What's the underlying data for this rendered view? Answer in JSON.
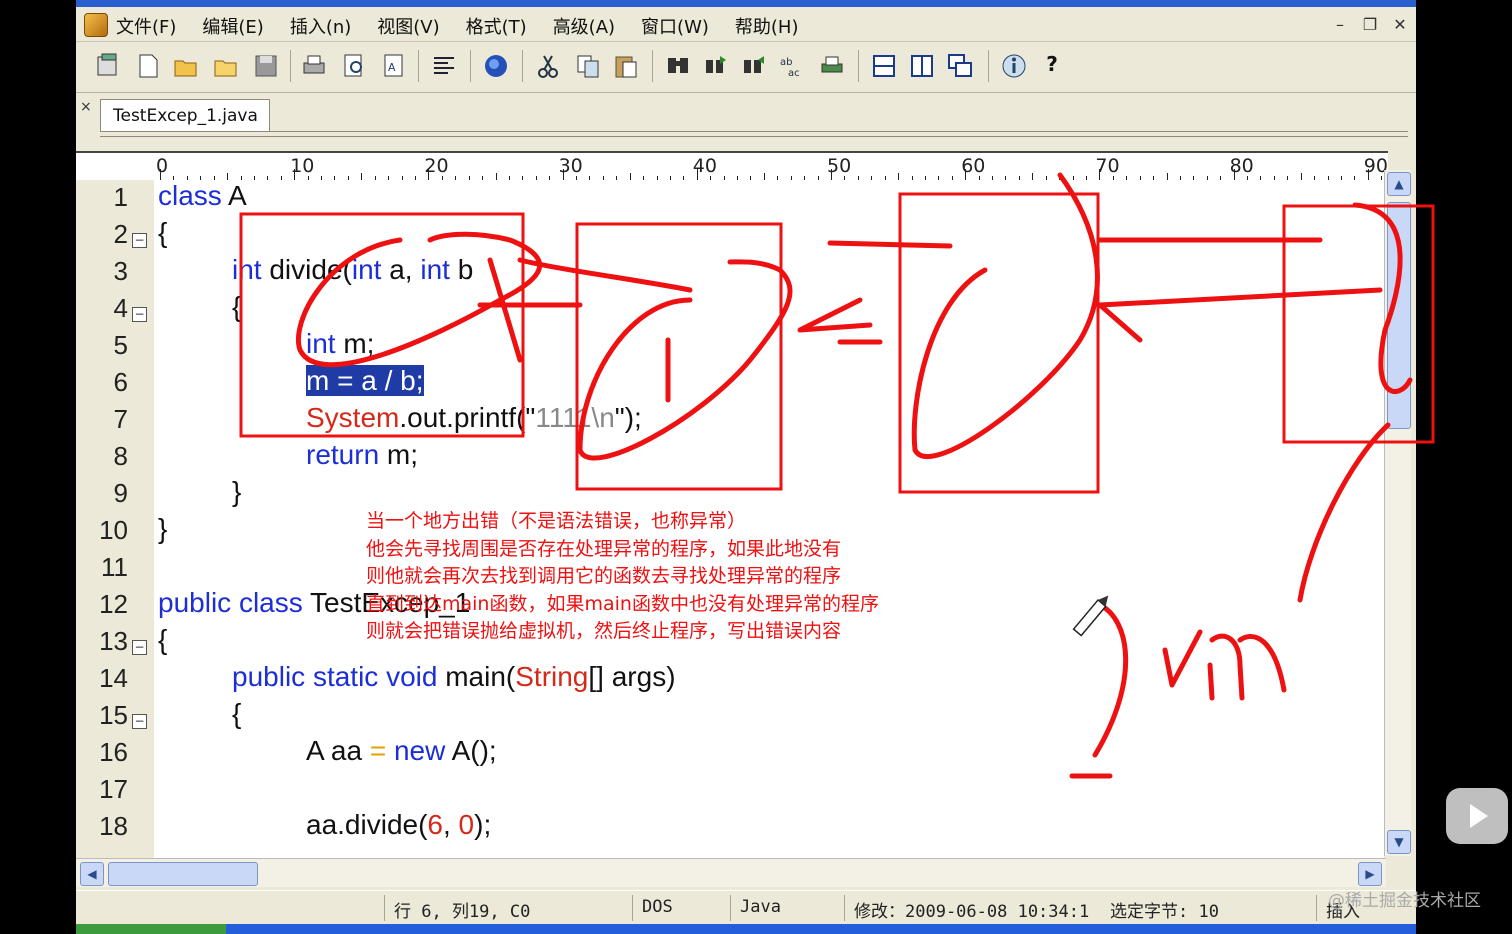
{
  "menu": {
    "items": [
      "文件(F)",
      "编辑(E)",
      "插入(n)",
      "视图(V)",
      "格式(T)",
      "高级(A)",
      "窗口(W)",
      "帮助(H)"
    ],
    "minimize": "–",
    "restore": "❐",
    "close": "✕"
  },
  "toolbar": {
    "icons": [
      "new-project-icon",
      "new-file-icon",
      "open-folder-icon",
      "open-folder-2-icon",
      "save-icon",
      "print-icon",
      "print-preview-icon",
      "spell-check-icon",
      "format-icon",
      "browser-icon",
      "cut-icon",
      "copy-icon",
      "paste-icon",
      "find-icon",
      "find-next-icon",
      "find-prev-icon",
      "replace-icon",
      "print-2-icon",
      "split-horizontal-icon",
      "split-vertical-icon",
      "cascade-icon",
      "info-icon",
      "help-icon"
    ],
    "help_label": "?"
  },
  "tabs": {
    "close_label": "×",
    "active": "TestExcep_1.java"
  },
  "ruler": {
    "labels": [
      "0",
      "10",
      "20",
      "30",
      "40",
      "50",
      "60",
      "70",
      "80",
      "90"
    ]
  },
  "editor": {
    "line_numbers": [
      "1",
      "2",
      "3",
      "4",
      "5",
      "6",
      "7",
      "8",
      "9",
      "10",
      "11",
      "12",
      "13",
      "14",
      "15",
      "16",
      "17",
      "18"
    ],
    "lines": {
      "l1_kw": "class",
      "l1_rest": " A",
      "l2": "{",
      "l3_kw1": "int",
      "l3_mid": " divide(",
      "l3_kw2": "int",
      "l3_mid2": " a, ",
      "l3_kw3": "int",
      "l3_end": " b",
      "l4": "{",
      "l5_kw": "int",
      "l5_rest": " m;",
      "l6_sel": "m = a / b;",
      "l7_cls": "System",
      "l7_mid": ".out.printf(\"",
      "l7_str": "1111\\n",
      "l7_end": "\");",
      "l8_kw": "return",
      "l8_rest": " m;",
      "l9": "}",
      "l10": "}",
      "l12_kw": "public class",
      "l12_rest": " TestExcep_1",
      "l13": "{",
      "l14_kw": "public static void",
      "l14_mid": " main(",
      "l14_cls": "String",
      "l14_end": "[] args)",
      "l15": "{",
      "l16_pre": "A aa ",
      "l16_op": "=",
      "l16_kw": " new",
      "l16_end": " A();",
      "l18_pre": "aa.divide(",
      "l18_n1": "6",
      "l18_mid": ", ",
      "l18_n2": "0",
      "l18_end": ");"
    }
  },
  "annotation": {
    "text": "当一个地方出错（不是语法错误，也称异常）\n他会先寻找周围是否存在处理异常的程序，如果此地没有\n则他就会再次去找到调用它的函数去寻找处理异常的程序\n直到到达main函数，如果main函数中也没有处理异常的程序\n则就会把错误抛给虚拟机，然后终止程序，写出错误内容",
    "handwriting": "jvm",
    "color": "#e11111"
  },
  "status": {
    "position": "行 6, 列19, C0",
    "line_ending": "DOS",
    "language": "Java",
    "modified": "修改：2009-06-08 10:34:1",
    "selected": "选定字节: 10",
    "mode": "插入"
  },
  "watermark": "@稀土掘金技术社区"
}
